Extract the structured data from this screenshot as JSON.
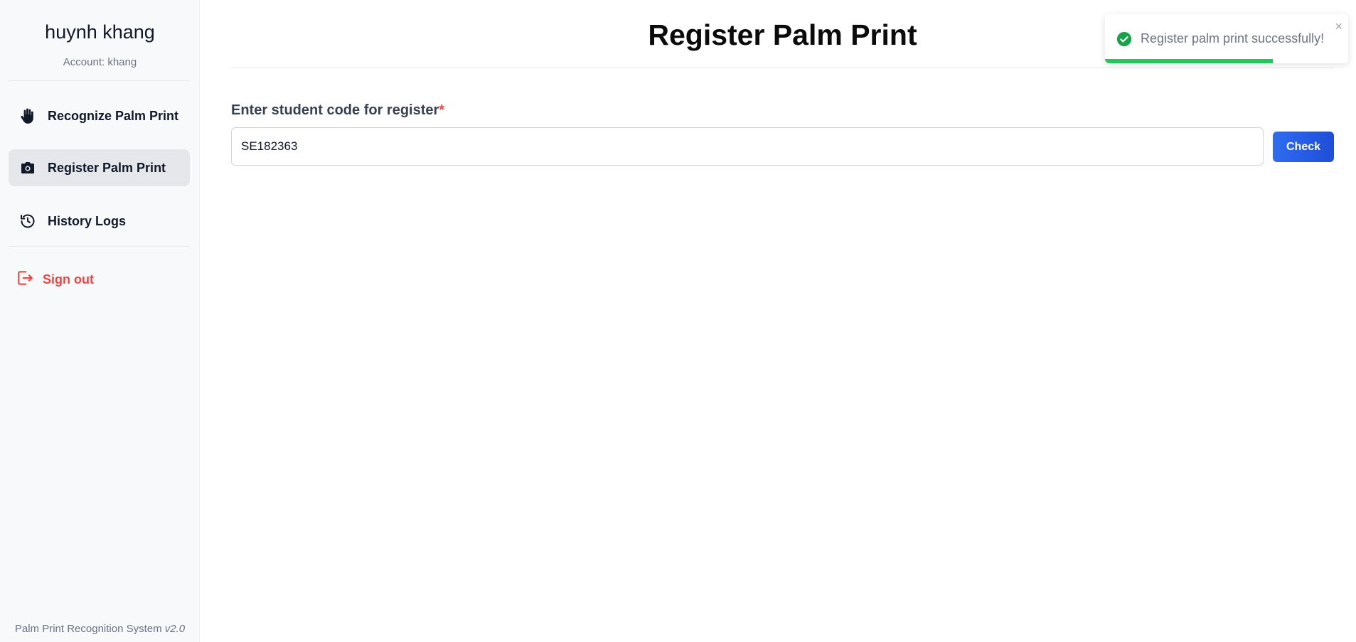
{
  "sidebar": {
    "user_name": "huynh khang",
    "account_line": "Account: khang",
    "items": [
      {
        "label": "Recognize Palm Print",
        "icon": "hand-icon",
        "active": false
      },
      {
        "label": "Register Palm Print",
        "icon": "camera-icon",
        "active": true
      },
      {
        "label": "History Logs",
        "icon": "history-icon",
        "active": false
      }
    ],
    "sign_out_label": "Sign out",
    "footer": {
      "system_name": "Palm Print Recognition System",
      "version": "v2.0"
    }
  },
  "main": {
    "title": "Register Palm Print",
    "field_label": "Enter student code for register",
    "required_marker": "*",
    "student_code_value": "SE182363",
    "check_label": "Check"
  },
  "toast": {
    "message": "Register palm print successfully!",
    "icon": "check-circle-icon",
    "close_glyph": "×",
    "progress_fraction": 0.69
  },
  "colors": {
    "accent": "#1d4ed8",
    "danger": "#ef4444",
    "success": "#22c55e",
    "sidebar_bg": "#f8f9fb",
    "active_item_bg": "#e5e7eb"
  }
}
